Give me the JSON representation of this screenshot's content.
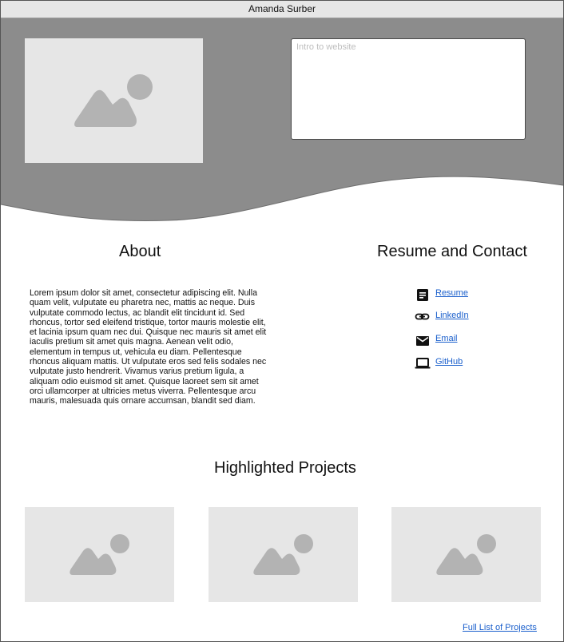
{
  "window": {
    "title": "Amanda Surber"
  },
  "colors": {
    "hero": "#8c8c8c",
    "placeholder_bg": "#e6e6e6",
    "placeholder_icon": "#b3b3b3",
    "link": "#1a5fcc"
  },
  "hero": {
    "image_icon": "image-icon",
    "intro_placeholder": "Intro to website"
  },
  "about": {
    "title": "About",
    "text": "Lorem ipsum dolor sit amet, consectetur adipiscing elit. Nulla quam velit, vulputate eu pharetra nec, mattis ac neque. Duis vulputate commodo lectus, ac blandit elit tincidunt id. Sed rhoncus, tortor sed eleifend tristique, tortor mauris molestie elit, et lacinia ipsum quam nec dui. Quisque nec mauris sit amet elit iaculis pretium sit amet quis magna. Aenean velit odio, elementum in tempus ut, vehicula eu diam. Pellentesque rhoncus aliquam mattis. Ut vulputate eros sed felis sodales nec vulputate justo hendrerit. Vivamus varius pretium ligula, a aliquam odio euismod sit amet. Quisque laoreet sem sit amet orci ullamcorper at ultricies metus viverra. Pellentesque arcu mauris, malesuada quis ornare accumsan, blandit sed diam."
  },
  "contact": {
    "title": "Resume and Contact",
    "items": [
      {
        "label": "Resume",
        "icon": "document-icon"
      },
      {
        "label": "LinkedIn",
        "icon": "link-icon"
      },
      {
        "label": "Email",
        "icon": "email-icon"
      },
      {
        "label": "GitHub",
        "icon": "laptop-icon"
      }
    ]
  },
  "projects": {
    "title": "Highlighted Projects",
    "items": [
      {
        "icon": "image-icon"
      },
      {
        "icon": "image-icon"
      },
      {
        "icon": "image-icon"
      }
    ],
    "full_list_label": "Full List of Projects"
  }
}
